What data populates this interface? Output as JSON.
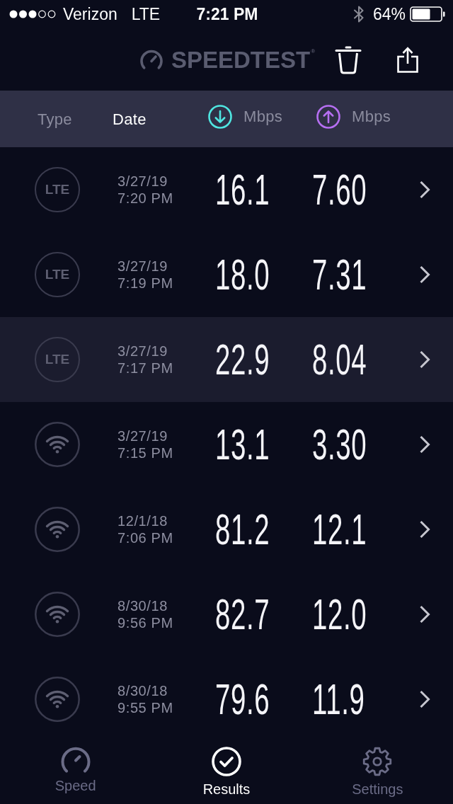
{
  "status_bar": {
    "carrier": "Verizon",
    "network": "LTE",
    "time": "7:21 PM",
    "battery": "64%"
  },
  "header": {
    "logo": "SPEEDTEST$^{®}$"
  },
  "columns": [
    {
      "kind": "plain",
      "label": "Type",
      "selected": false
    },
    {
      "kind": "plain",
      "label": "Date",
      "selected": true
    },
    {
      "kind": "download",
      "label": "Mbps",
      "selected": false
    },
    {
      "kind": "upload",
      "label": "Mbps",
      "selected": false
    }
  ],
  "rows": [
    {
      "kind": "cellular",
      "network": "LTE",
      "date": "3/27/19",
      "time": "7:20 PM",
      "download": "16.1",
      "upload": "7.60",
      "selected": false
    },
    {
      "kind": "cellular",
      "network": "LTE",
      "date": "3/27/19",
      "time": "7:19 PM",
      "download": "18.0",
      "upload": "7.31",
      "selected": false
    },
    {
      "kind": "cellular",
      "network": "LTE",
      "date": "3/27/19",
      "time": "7:17 PM",
      "download": "22.9",
      "upload": "8.04",
      "selected": true
    },
    {
      "kind": "wifi",
      "date": "3/27/19",
      "time": "7:15 PM",
      "download": "13.1",
      "upload": "3.30",
      "selected": false
    },
    {
      "kind": "wifi",
      "date": "12/1/18",
      "time": "7:06 PM",
      "download": "81.2",
      "upload": "12.1",
      "selected": false
    },
    {
      "kind": "wifi",
      "date": "8/30/18",
      "time": "9:56 PM",
      "download": "82.7",
      "upload": "12.0",
      "selected": false
    },
    {
      "kind": "wifi",
      "date": "8/30/18",
      "time": "9:55 PM",
      "download": "79.6",
      "upload": "11.9",
      "selected": false
    }
  ],
  "tab_bar": [
    {
      "label": "Speed",
      "selected": false
    },
    {
      "label": "Results",
      "selected": true
    },
    {
      "label": "Settings",
      "selected": false
    }
  ]
}
